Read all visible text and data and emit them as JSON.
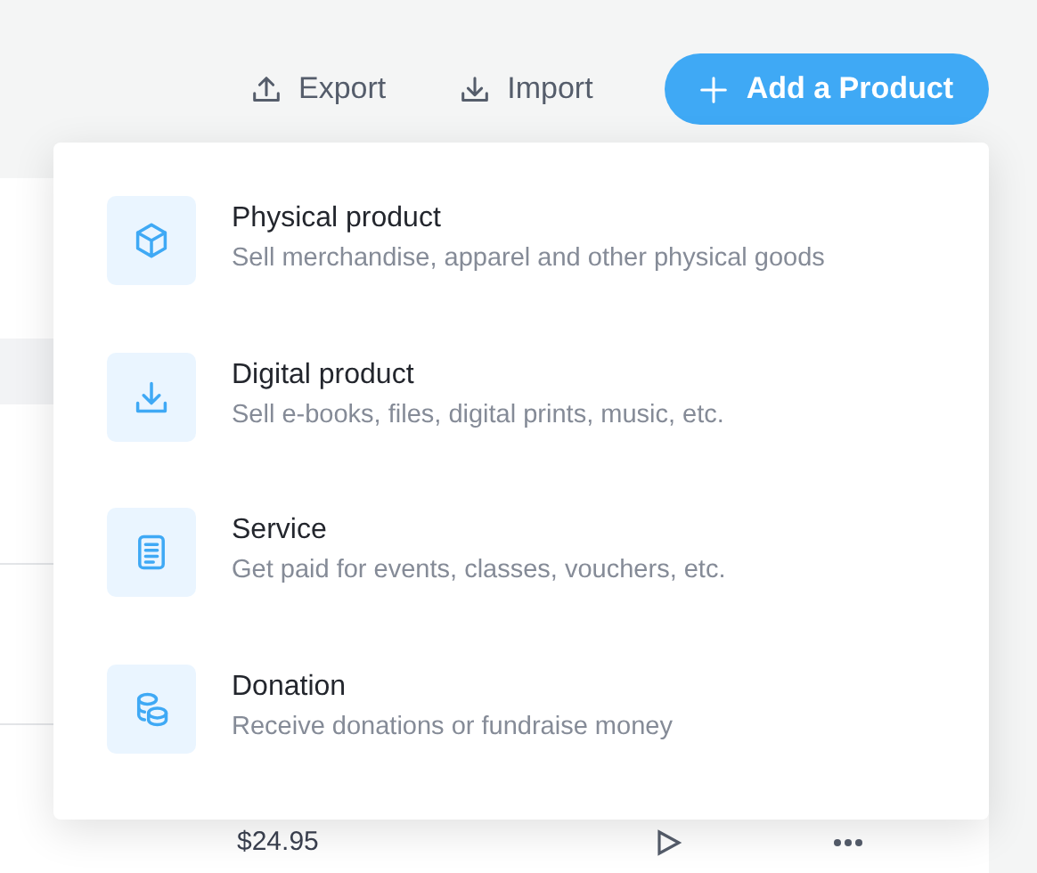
{
  "toolbar": {
    "buttons": [
      {
        "kind": "export",
        "label": "Export"
      },
      {
        "kind": "import",
        "label": "Import"
      },
      {
        "kind": "add",
        "label": "Add a Product"
      }
    ]
  },
  "table_row": {
    "price": "$24.95"
  },
  "menu": {
    "items": [
      {
        "kind": "box",
        "title": "Physical product",
        "description": "Sell merchandise, apparel and other physical goods"
      },
      {
        "kind": "download",
        "title": "Digital product",
        "description": "Sell e-books, files, digital prints, music, etc."
      },
      {
        "kind": "document",
        "title": "Service",
        "description": "Get paid for events, classes, vouchers, etc."
      },
      {
        "kind": "coins",
        "title": "Donation",
        "description": "Receive donations or fundraise money"
      }
    ]
  }
}
